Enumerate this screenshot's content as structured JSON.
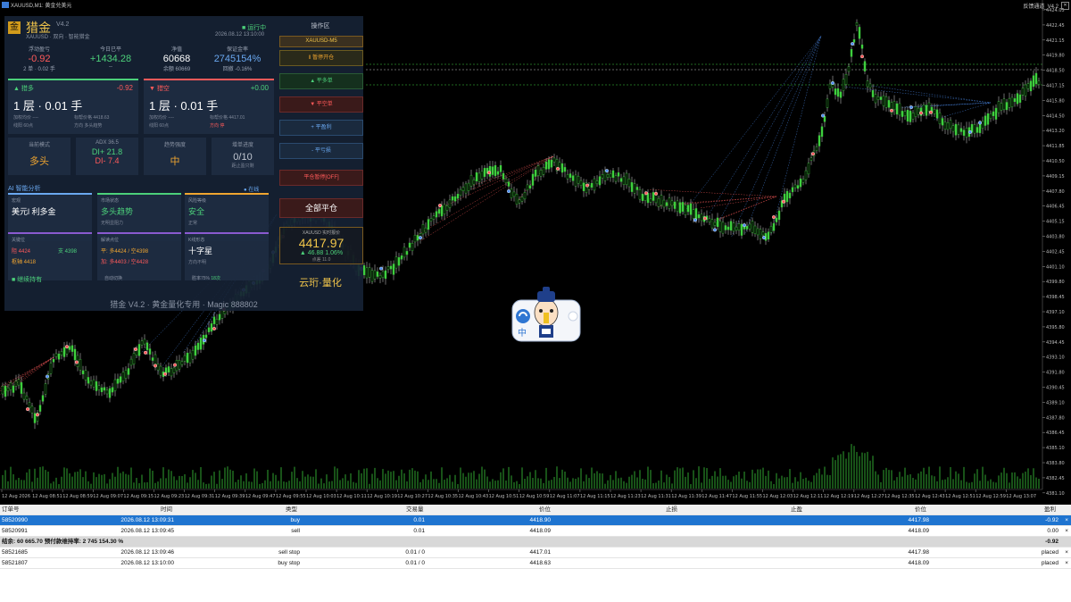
{
  "window": {
    "title": "XAUUSD,M1: 黄金兑美元",
    "right_label": "反馈通道_V4.2",
    "close_glyph": "✕"
  },
  "panel": {
    "logo_char": "金",
    "title": "猎金",
    "version": "V4.2",
    "subtitle": "XAUUSD · 双向 · 智能猎金",
    "status": "运行中",
    "datetime": "2026.08.12 13:10:00",
    "stats": [
      {
        "label": "浮动盈亏",
        "value": "-0.92",
        "sub": "2 单 · 0.02 手",
        "color": "#ff5a5a"
      },
      {
        "label": "今日已平",
        "value": "+1434.28",
        "sub": "--",
        "color": "#4cd07a"
      },
      {
        "label": "净值",
        "value": "60668",
        "sub": "余额 60669",
        "color": "#ffffff"
      },
      {
        "label": "保证金率",
        "value": "2745154%",
        "sub": "回撤 -0.16%",
        "color": "#6aa8f0"
      }
    ],
    "long": {
      "label": "▲ 猎多",
      "pnl": "-0.92",
      "size": "1 层 · 0.01 手",
      "d1": "加权均价 ----",
      "d2": "线阳 60点",
      "d3": "标帮价格 4418.63",
      "d4": "方向 多头趋势"
    },
    "short": {
      "label": "▼ 猎空",
      "pnl": "+0.00",
      "size": "1 层 · 0.01 手",
      "d1": "加权均价 ----",
      "d2": "线阳 60点",
      "d3": "标帮价格 4417.01",
      "d4": "方向 停"
    },
    "cards": [
      {
        "label": "当前模式",
        "value": "多头",
        "sub": "",
        "color": "#f0a530"
      },
      {
        "label": "ADX 36.5",
        "value": "DI+ 21.8",
        "value2": "DI- 7.4",
        "color": "#4cd07a",
        "color2": "#ff5a5a"
      },
      {
        "label": "趋势强度",
        "value": "中",
        "sub": "",
        "color": "#f0a530"
      },
      {
        "label": "增单进度",
        "value": "0/10",
        "sub": "距止盈只剩",
        "color": "#c0c6d0"
      }
    ],
    "ai_header": "AI 智能分析",
    "ai_tag": "● 在线",
    "ai_cells": [
      {
        "label": "宏观",
        "value": "美元l 利多金",
        "sub": "",
        "color": "#ffffff"
      },
      {
        "label": "市场状态",
        "value": "多头趋势",
        "sub": "无明显阻力",
        "color": "#4cd07a"
      },
      {
        "label": "风险等级",
        "value": "安全",
        "sub": "正常",
        "color": "#4cd07a"
      }
    ],
    "ai_levels": {
      "label": "关键位",
      "r1": "阻 4424",
      "s1": "支 4398",
      "r2": "枢轴 4418"
    },
    "ai_breakout": {
      "label": "解读点位",
      "l1": "平: 多4424 / 空4398",
      "l2": "加: 多4403 / 空4428"
    },
    "ai_pattern": {
      "label": "K线形态",
      "value": "十字星",
      "sub": "方向不明"
    },
    "foot_left": "■ 继续持有",
    "foot_mid": "自动切换",
    "foot_right": "胜率75%",
    "foot_count": "18次",
    "bottom": "猎金 V4.2 · 黄金量化专用 · Magic 888802"
  },
  "ops": {
    "title": "操作区",
    "symbol": "XAUUSD-M5",
    "buttons": [
      {
        "label": "‖ 暂停开仓",
        "color": "#f0a530",
        "bg": "#2a2a1a"
      },
      {
        "label": "▲ 平多单",
        "color": "#4cd07a",
        "bg": "#15301e"
      },
      {
        "label": "▼ 平空单",
        "color": "#ff5a5a",
        "bg": "#3a1a1a"
      },
      {
        "label": "+ 平盈利",
        "color": "#6aa8f0",
        "bg": "#1a2a3e"
      },
      {
        "label": "- 平亏损",
        "color": "#6aa8f0",
        "bg": "#1a2a3e"
      },
      {
        "label": "平仓暂停[OFF]",
        "color": "#ff5a5a",
        "bg": "#3a1a1a"
      }
    ],
    "close_all": "全部平仓",
    "price_label": "XAUUSD 实时报价",
    "price": "4417.97",
    "change": "▲ 46.88 1.06%",
    "spread": "点差 11.0",
    "brand": "云珩·量化"
  },
  "mascot": {
    "tag": "中"
  },
  "chart": {
    "y_ticks": [
      "4424.05",
      "4422.45",
      "4421.15",
      "4419.80",
      "4418.50",
      "4417.15",
      "4415.80",
      "4414.50",
      "4413.20",
      "4411.85",
      "4410.50",
      "4409.15",
      "4407.80",
      "4406.45",
      "4405.15",
      "4403.80",
      "4402.45",
      "4401.10",
      "4399.80",
      "4398.45",
      "4397.10",
      "4395.80",
      "4394.45",
      "4393.10",
      "4391.80",
      "4390.45",
      "4389.10",
      "4387.80",
      "4386.45",
      "4385.10",
      "4383.80",
      "4382.45",
      "4381.10"
    ],
    "x_ticks": [
      "12 Aug 2026",
      "12 Aug 08:51",
      "12 Aug 08:59",
      "12 Aug 09:07",
      "12 Aug 09:15",
      "12 Aug 09:23",
      "12 Aug 09:31",
      "12 Aug 09:39",
      "12 Aug 09:47",
      "12 Aug 09:55",
      "12 Aug 10:03",
      "12 Aug 10:11",
      "12 Aug 10:19",
      "12 Aug 10:27",
      "12 Aug 10:35",
      "12 Aug 10:43",
      "12 Aug 10:51",
      "12 Aug 10:59",
      "12 Aug 11:07",
      "12 Aug 11:15",
      "12 Aug 11:23",
      "12 Aug 11:31",
      "12 Aug 11:39",
      "12 Aug 11:47",
      "12 Aug 11:55",
      "12 Aug 12:03",
      "12 Aug 12:11",
      "12 Aug 12:19",
      "12 Aug 12:27",
      "12 Aug 12:35",
      "12 Aug 12:43",
      "12 Aug 12:51",
      "12 Aug 12:59",
      "12 Aug 13:07"
    ]
  },
  "table": {
    "headers": [
      "订单号",
      "时间",
      "类型",
      "交易量",
      "价位",
      "止损",
      "止盈",
      "价位",
      "盈利"
    ],
    "rows": [
      {
        "ticket": "58520990",
        "time": "2026.08.12 13:09:31",
        "type": "buy",
        "volume": "0.01",
        "price": "4418.90",
        "sl": "",
        "tp": "",
        "cur": "4417.98",
        "profit": "-0.92",
        "sel": true
      },
      {
        "ticket": "58520991",
        "time": "2026.08.12 13:09:45",
        "type": "sell",
        "volume": "0.01",
        "price": "4418.09",
        "sl": "",
        "tp": "",
        "cur": "4418.09",
        "profit": "0.00",
        "sel": false
      }
    ],
    "summary": "结余: 60 665.70  预付款维持率: 2 745 154.30 %",
    "summary_profit": "-0.92",
    "pending": [
      {
        "ticket": "58521685",
        "time": "2026.08.12 13:09:46",
        "type": "sell stop",
        "volume": "0.01 / 0",
        "price": "4417.01",
        "sl": "",
        "tp": "",
        "cur": "4417.98",
        "profit": "placed"
      },
      {
        "ticket": "58521807",
        "time": "2026.08.12 13:10:00",
        "type": "buy stop",
        "volume": "0.01 / 0",
        "price": "4418.63",
        "sl": "",
        "tp": "",
        "cur": "4418.09",
        "profit": "placed"
      }
    ]
  }
}
